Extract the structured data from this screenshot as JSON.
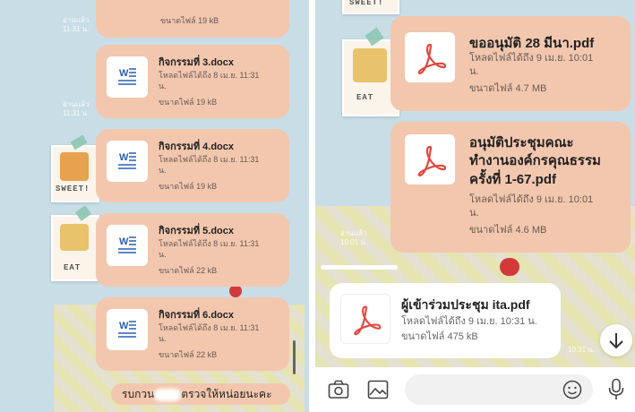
{
  "left_panel": {
    "timestamps": [
      "อ่านแล้ว\n11:31 น.",
      "อ่านแล้ว\n11:31 น."
    ],
    "files": [
      {
        "name": "",
        "downloaded": "",
        "size": "ขนาดไฟล์ 19 kB"
      },
      {
        "name": "กิจกรรมที่ 3.docx",
        "downloaded": "โหลดไฟล์ได้ถึง 8 เม.ย. 11:31\nน.",
        "size": "ขนาดไฟล์ 19 kB"
      },
      {
        "name": "กิจกรรมที่ 4.docx",
        "downloaded": "โหลดไฟล์ได้ถึง 8 เม.ย. 11:31\nน.",
        "size": "ขนาดไฟล์ 19 kB"
      },
      {
        "name": "กิจกรรมที่ 5.docx",
        "downloaded": "โหลดไฟล์ได้ถึง 8 เม.ย. 11:31\nน.",
        "size": "ขนาดไฟล์ 22 kB"
      },
      {
        "name": "กิจกรรมที่ 6.docx",
        "downloaded": "โหลดไฟล์ได้ถึง 8 เม.ย. 11:31\nน.",
        "size": "ขนาดไฟล์ 22 kB"
      }
    ],
    "message_prefix": "รบกวน",
    "message_suffix": "ตรวจให้หน่อยนะคะ",
    "sticker_labels": [
      "SWEET!",
      "EAT"
    ]
  },
  "right_panel": {
    "files": [
      {
        "name": "ขออนุมัติ 28 มีนา.pdf",
        "downloaded": "โหลดไฟล์ได้ถึง 9 เม.ย. 10:01\nน.",
        "size": "ขนาดไฟล์ 4.7 MB"
      },
      {
        "name": "อนุมัติประชุมคณะ\nทำงานองค์กรคุณธรรม\nครั้งที่ 1-67.pdf",
        "downloaded": "โหลดไฟล์ได้ถึง 9 เม.ย. 10:01\nน.",
        "size": "ขนาดไฟล์ 4.6 MB"
      },
      {
        "name": "ผู้เข้าร่วมประชุม ita.pdf",
        "downloaded": "โหลดไฟล์ได้ถึง 9 เม.ย. 10:31 น.",
        "size": "ขนาดไฟล์ 475 kB"
      }
    ],
    "timestamps": [
      "อ่านแล้ว\n10:01 น.",
      "10:31 น."
    ],
    "sticker_labels": [
      "SWEET!",
      "EAT"
    ]
  },
  "icons": [
    "word-doc-icon",
    "pdf-icon",
    "camera-icon",
    "image-icon",
    "emoji-icon",
    "microphone-icon",
    "arrow-down-icon"
  ],
  "colors": {
    "card": "#f2c7ae",
    "wallpaper": "#c9dde6",
    "pdf_red": "#e2473f",
    "word_blue": "#2b5fb4"
  }
}
